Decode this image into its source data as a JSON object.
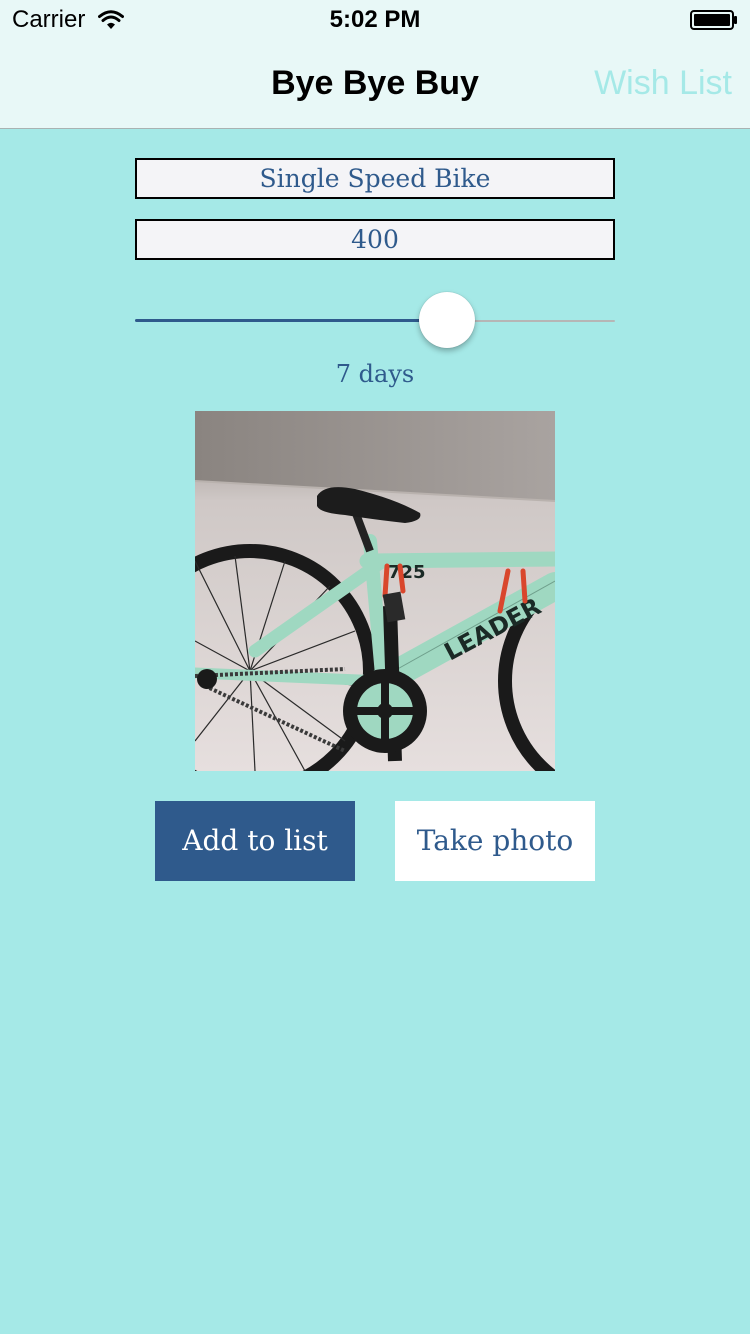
{
  "status_bar": {
    "carrier": "Carrier",
    "time": "5:02 PM",
    "wifi_icon": "wifi-icon",
    "battery_icon": "battery-icon"
  },
  "nav": {
    "title": "Bye Bye Buy",
    "right_button": "Wish List"
  },
  "form": {
    "item_name": "Single Speed Bike",
    "price": "400",
    "days_label": "7 days",
    "slider_fraction": 0.65
  },
  "buttons": {
    "add": "Add to list",
    "photo": "Take photo"
  },
  "colors": {
    "background": "#a5e9e7",
    "accent": "#2f5a8c"
  },
  "photo": {
    "frame_lettering": "LEADER",
    "frame_number": "725"
  }
}
